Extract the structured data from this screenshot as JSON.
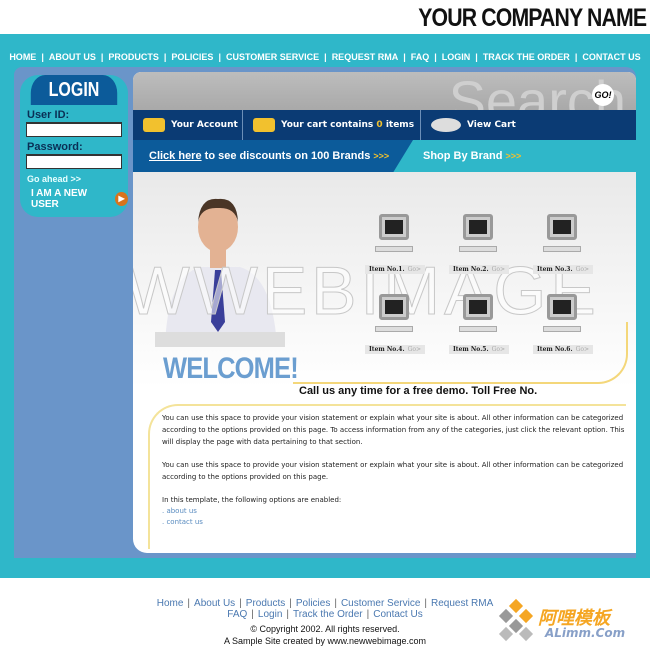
{
  "header": {
    "company_name": "YOUR COMPANY NAME"
  },
  "nav": [
    "HOME",
    "ABOUT US",
    "PRODUCTS",
    "POLICIES",
    "CUSTOMER SERVICE",
    "REQUEST RMA",
    "FAQ",
    "LOGIN",
    "TRACK THE ORDER",
    "CONTACT US"
  ],
  "login": {
    "title": "LOGIN",
    "user_label": "User ID:",
    "user_value": "",
    "password_label": "Password:",
    "password_value": "",
    "go_ahead": "Go ahead >>",
    "new_user": "I AM A NEW USER"
  },
  "search": {
    "go_label": "GO!",
    "watermark": "Search"
  },
  "account_bar": {
    "account": "Your Account",
    "cart_prefix": "Your cart contains ",
    "cart_count": "0",
    "cart_suffix": " items",
    "view_cart": "View Cart"
  },
  "promo": {
    "link": "Click here",
    "text": " to see discounts on 100 Brands ",
    "chev": ">>>",
    "shop_by_brand": "Shop By Brand "
  },
  "hero": {
    "watermark": "NEWWEBIMAGE",
    "welcome": "WELCOME!",
    "products": [
      {
        "label": "Item No.1.",
        "go": "Go>"
      },
      {
        "label": "Item No.2.",
        "go": "Go>"
      },
      {
        "label": "Item No.3.",
        "go": "Go>"
      },
      {
        "label": "Item No.4.",
        "go": "Go>"
      },
      {
        "label": "Item No.5.",
        "go": "Go>"
      },
      {
        "label": "Item No.6.",
        "go": "Go>"
      }
    ]
  },
  "content": {
    "callus": "Call us any time for a free demo. Toll Free No.",
    "p1": "You can use this space to provide your vision statement or explain what your site is about. All other information can be categorized according to the options provided on this page. To access information from any of the categories, just click the relevant option. This will display the page with data pertaining to that section.",
    "p2": "You can use this space to provide your vision statement or explain what your site is about. All other information can be categorized according to the options provided on this page.",
    "p3": "In this template, the following options are enabled:",
    "links": [
      ". about us",
      ". contact us"
    ]
  },
  "footer": {
    "row1": [
      "Home",
      "About Us",
      "Products",
      "Policies",
      "Customer Service",
      "Request RMA"
    ],
    "row2": [
      "FAQ",
      "Login",
      "Track the Order",
      "Contact Us"
    ],
    "copyright": "© Copyright 2002. All rights reserved.",
    "credit": "A Sample Site created by www.newwebimage.com"
  },
  "watermark_logo": {
    "cn": "阿哩模板",
    "en": "ALimm.Com"
  },
  "colors": {
    "teal": "#2fb7c9",
    "navy": "#0b3b74",
    "blue": "#0c5b9a",
    "accent": "#f2c12e"
  }
}
